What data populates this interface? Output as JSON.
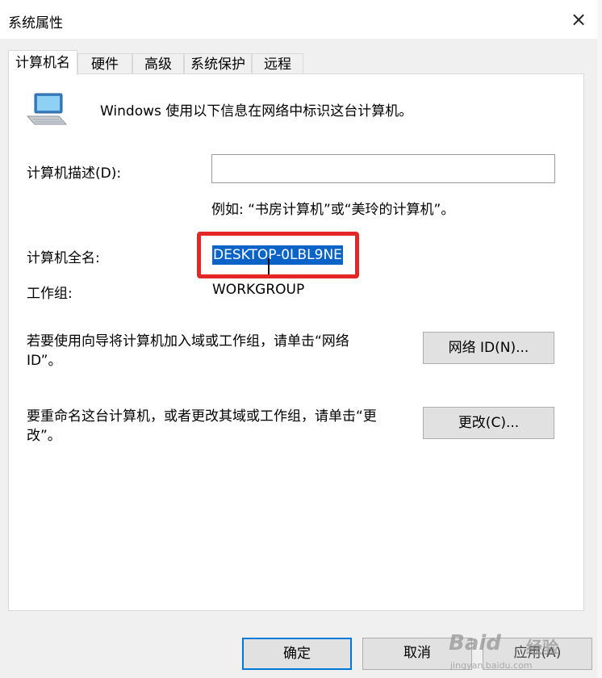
{
  "window": {
    "title": "系统属性",
    "close_icon": "×"
  },
  "tabs": [
    {
      "label": "计算机名",
      "active": true
    },
    {
      "label": "硬件",
      "active": false
    },
    {
      "label": "高级",
      "active": false
    },
    {
      "label": "系统保护",
      "active": false
    },
    {
      "label": "远程",
      "active": false
    }
  ],
  "panel": {
    "intro": "Windows 使用以下信息在网络中标识这台计算机。",
    "description_label": "计算机描述(D):",
    "description_value": "",
    "description_example": "例如: “书房计算机”或“美玲的计算机”。",
    "full_name_label": "计算机全名:",
    "full_name_value": "DESKTOP-0LBL9NE",
    "workgroup_label": "工作组:",
    "workgroup_value": "WORKGROUP",
    "network_id_text": "若要使用向导将计算机加入域或工作组，请单击“网络 ID”。",
    "network_id_button": "网络 ID(N)...",
    "rename_text": "要重命名这台计算机，或者更改其域或工作组，请单击“更改”。",
    "change_button": "更改(C)..."
  },
  "footer": {
    "ok": "确定",
    "cancel": "取消",
    "apply": "应用(A)"
  },
  "watermark": {
    "logo": "Baid",
    "sub": "经验",
    "url": "jingyan.baidu.com"
  },
  "colors": {
    "accent": "#0078d7",
    "highlight_box": "#e32727",
    "selection": "#0a64c8"
  }
}
